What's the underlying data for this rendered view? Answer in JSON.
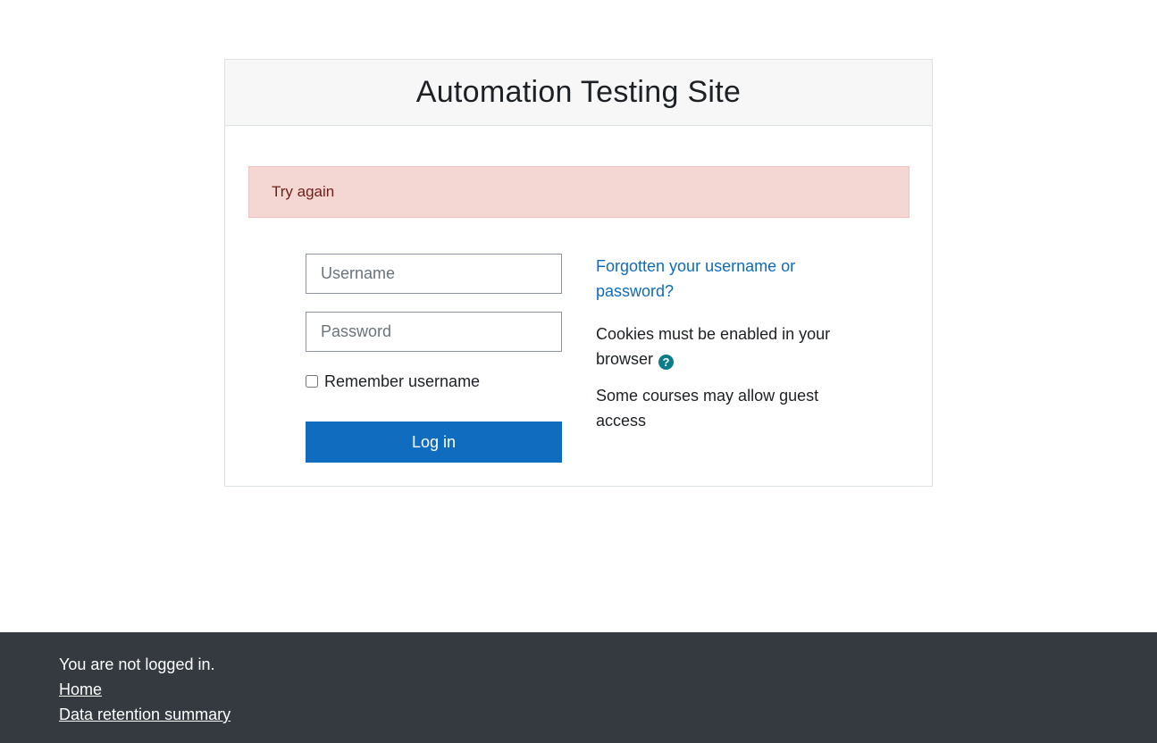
{
  "header": {
    "site_title": "Automation Testing Site"
  },
  "alert": {
    "message": "Try again"
  },
  "form": {
    "username_placeholder": "Username",
    "username_value": "",
    "password_placeholder": "Password",
    "password_value": "",
    "remember_label": "Remember username",
    "remember_checked": false,
    "login_label": "Log in"
  },
  "info": {
    "forgot_link": "Forgotten your username or password?",
    "cookies_text": "Cookies must be enabled in your browser",
    "help_icon": "question-circle-icon",
    "guest_text": "Some courses may allow guest access"
  },
  "footer": {
    "status_text": "You are not logged in.",
    "home_link": "Home",
    "data_retention_link": "Data retention summary"
  },
  "colors": {
    "primary": "#0f6cbf",
    "alert_bg": "#f4d6d2",
    "alert_text": "#6e211a",
    "footer_bg": "#343a40",
    "help_icon": "#0b7d8a"
  }
}
